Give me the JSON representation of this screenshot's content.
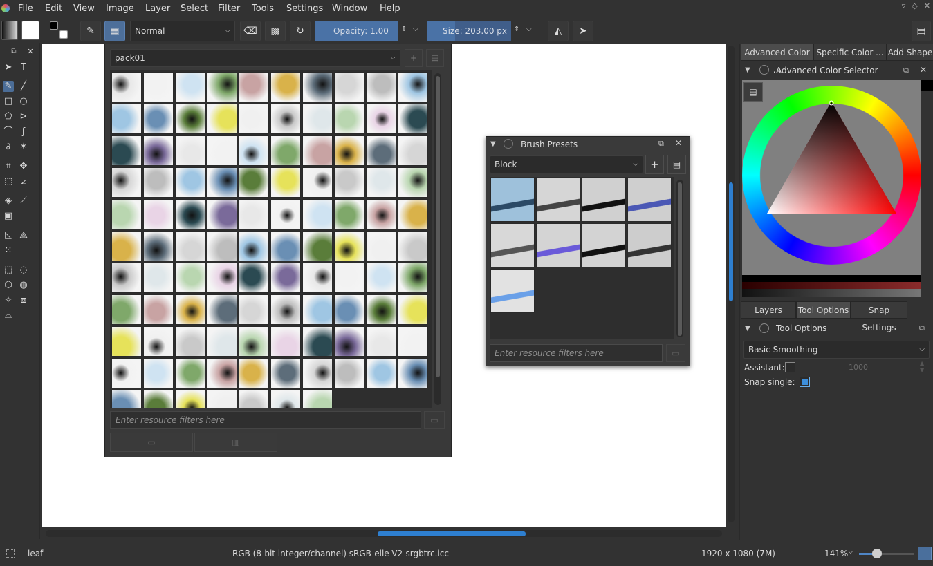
{
  "menubar": {
    "items": [
      "File",
      "Edit",
      "View",
      "Image",
      "Layer",
      "Select",
      "Filter",
      "Tools",
      "Settings",
      "Window",
      "Help"
    ]
  },
  "toolbar": {
    "blend_mode": "Normal",
    "opacity_label": "Opacity:  1.00",
    "opacity_value": 1.0,
    "size_label": "Size:  203.00 px",
    "size_value": 203.0
  },
  "brush_popup": {
    "tag_select": "pack01",
    "filter_placeholder": "Enter resource filters here"
  },
  "brush_presets": {
    "title": "Brush Presets",
    "tag_select": "Block",
    "filter_placeholder": "Enter resource filters here"
  },
  "right_dock": {
    "top_tabs": [
      "Advanced Color ...",
      "Specific Color ...",
      "Add Shape"
    ],
    "color_docker_title": "Advanced Color Selector",
    "bottom_tabs": [
      "Layers",
      "Tool Options",
      "Snap Settings"
    ],
    "tool_options_title": "Tool Options",
    "smoothing": "Basic Smoothing",
    "assistant_label": "Assistant:",
    "assistant_value": "1000",
    "snap_single_label": "Snap single:"
  },
  "statusbar": {
    "layer_name": "leaf",
    "color_profile": "RGB (8-bit integer/channel)  sRGB-elle-V2-srgbtrc.icc",
    "image_size": "1920 x 1080 (7M)",
    "zoom": "141%"
  }
}
